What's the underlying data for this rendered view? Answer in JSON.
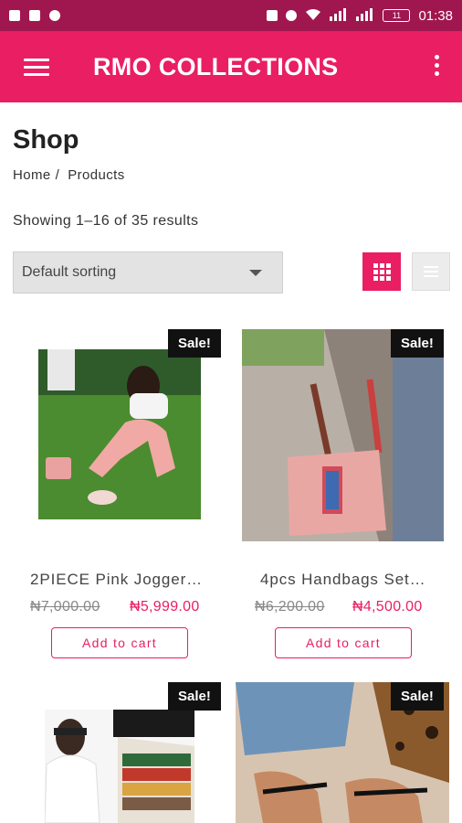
{
  "status_bar": {
    "time": "01:38",
    "battery": "11"
  },
  "app_bar": {
    "title": "RMO COLLECTIONS"
  },
  "page": {
    "title": "Shop",
    "breadcrumb": [
      "Home",
      "Products"
    ],
    "breadcrumb_sep": "/",
    "results_text": "Showing 1–16 of 35 results",
    "sorting_selected": "Default sorting"
  },
  "colors": {
    "accent": "#e91e63",
    "status_bar": "#a0174f"
  },
  "products": [
    {
      "badge": "Sale!",
      "name": "2PIECE Pink Jogger…",
      "old_price": "₦7,000.00",
      "new_price": "₦5,999.00",
      "button": "Add to cart"
    },
    {
      "badge": "Sale!",
      "name": "4pcs Handbags Set…",
      "old_price": "₦6,200.00",
      "new_price": "₦4,500.00",
      "button": "Add to cart"
    },
    {
      "badge": "Sale!"
    },
    {
      "badge": "Sale!"
    }
  ]
}
